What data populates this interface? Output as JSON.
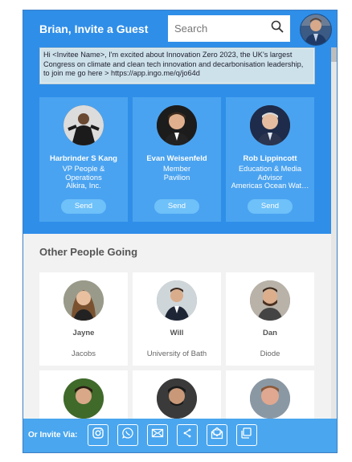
{
  "header": {
    "title": "Brian, Invite a Guest",
    "search_placeholder": "Search"
  },
  "message": "Hi <Invitee Name>, I'm excited about Innovation Zero 2023, the UK's largest Congress on climate and clean tech innovation and decarbonisation leadership, to join me go here > https://app.ingo.me/q/jo64d",
  "featured": [
    {
      "name": "Harbrinder S Kang",
      "title": "VP People &\nOperations\nAlkira, Inc.",
      "send_label": "Send"
    },
    {
      "name": "Evan Weisenfeld",
      "title": "Member\nPavilion",
      "send_label": "Send"
    },
    {
      "name": "Rob Lippincott",
      "title": "Education & Media\nAdvisor\nAmericas Ocean Wat…",
      "send_label": "Send"
    }
  ],
  "other_section_title": "Other People Going",
  "people": [
    {
      "first_name": "Jayne",
      "org": "Jacobs"
    },
    {
      "first_name": "Will",
      "org": "University of Bath"
    },
    {
      "first_name": "Dan",
      "org": "Diode"
    },
    {
      "first_name": "",
      "org": ""
    },
    {
      "first_name": "",
      "org": ""
    },
    {
      "first_name": "",
      "org": ""
    }
  ],
  "invite_bar": {
    "label": "Or Invite Via:",
    "options": [
      "instagram-icon",
      "whatsapp-icon",
      "email-icon",
      "share-icon",
      "mail-open-icon",
      "copy-icon"
    ]
  },
  "colors": {
    "primary": "#2f8ee8",
    "card": "#4aa3f0",
    "send_button": "#6ec1f9",
    "invite_bar": "#4aa6ee"
  }
}
